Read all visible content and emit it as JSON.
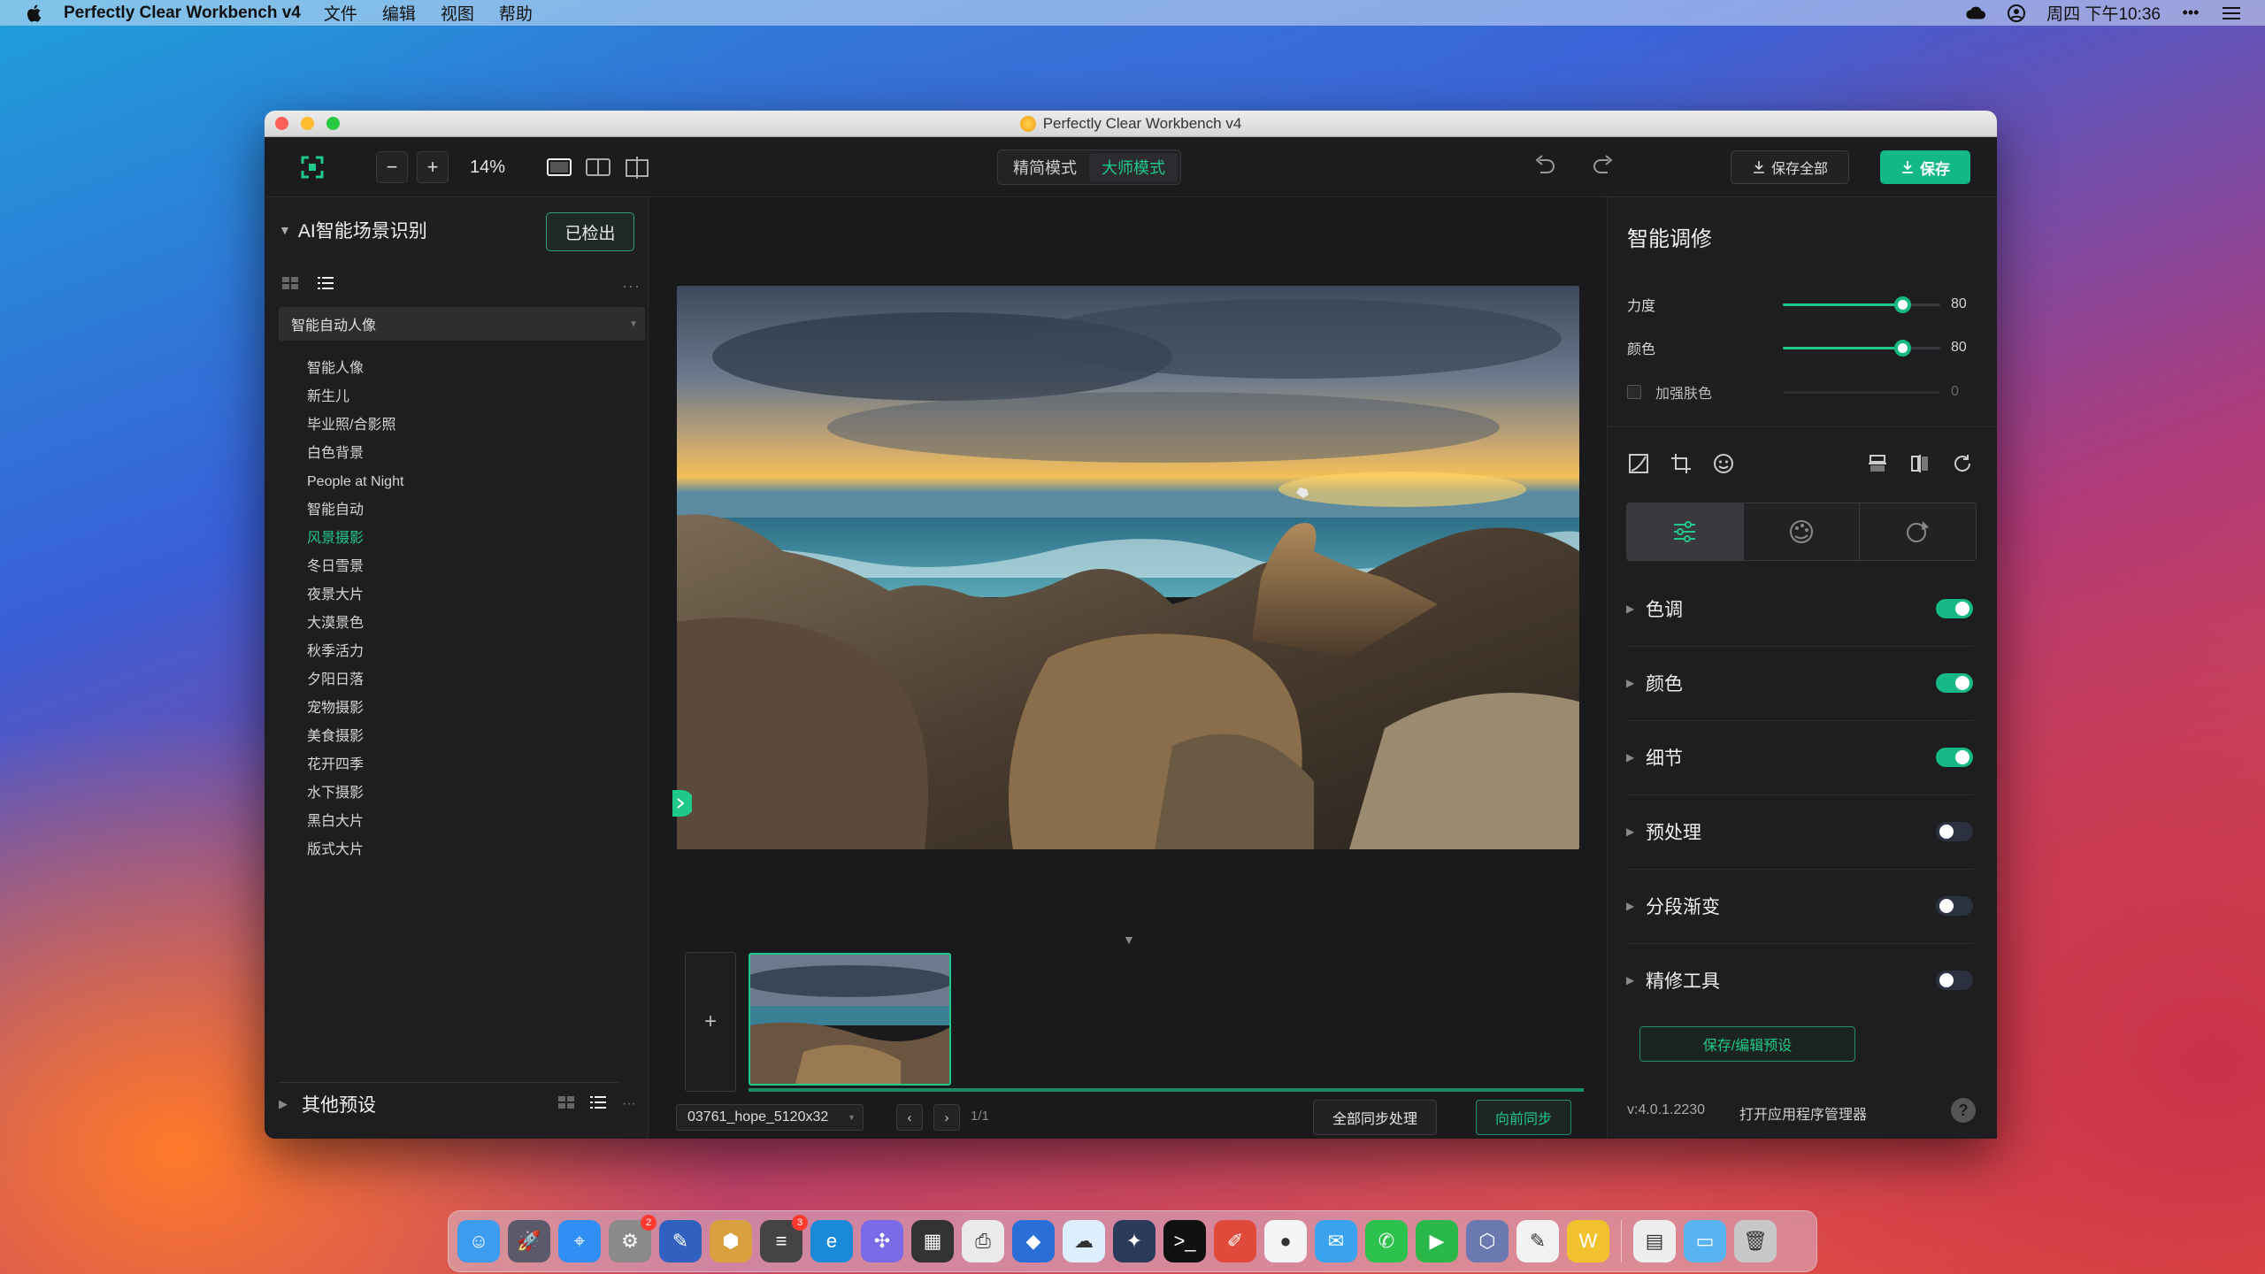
{
  "menubar": {
    "app_name": "Perfectly Clear Workbench v4",
    "menus": [
      "文件",
      "编辑",
      "视图",
      "帮助"
    ],
    "datetime": "周四 下午10:36"
  },
  "window": {
    "title": "Perfectly Clear Workbench v4"
  },
  "toolbar": {
    "zoom_value": "14%",
    "modes": [
      "精简模式",
      "大师模式"
    ],
    "active_mode": "大师模式",
    "save_all_label": "保存全部",
    "save_label": "保存",
    "accent_color": "#12b986"
  },
  "left_panel": {
    "title": "AI智能场景识别",
    "detected_label": "已检出",
    "dropdown_value": "智能自动人像",
    "presets": [
      "智能人像",
      "新生儿",
      "毕业照/合影照",
      "白色背景",
      "People at Night",
      "智能自动",
      "风景摄影",
      "冬日雪景",
      "夜景大片",
      "大漠景色",
      "秋季活力",
      "夕阳日落",
      "宠物摄影",
      "美食摄影",
      "花开四季",
      "水下摄影",
      "黑白大片",
      "版式大片"
    ],
    "active_preset": "风景摄影",
    "other_presets_label": "其他预设"
  },
  "center": {
    "file_name": "03761_hope_5120x32",
    "page_count": "1/1",
    "sync_all_label": "全部同步处理",
    "sync_forward_label": "向前同步",
    "add_label": "+"
  },
  "right_panel": {
    "title": "智能调修",
    "sliders": [
      {
        "label": "力度",
        "value": 80,
        "enabled": true
      },
      {
        "label": "颜色",
        "value": 80,
        "enabled": true
      },
      {
        "label": "加强肤色",
        "value": 0,
        "enabled": false
      }
    ],
    "sections": [
      {
        "label": "色调",
        "on": true
      },
      {
        "label": "颜色",
        "on": true
      },
      {
        "label": "细节",
        "on": true
      },
      {
        "label": "预处理",
        "on": false
      },
      {
        "label": "分段渐变",
        "on": false
      },
      {
        "label": "精修工具",
        "on": false
      }
    ],
    "save_preset_label": "保存/编辑预设",
    "version": "v:4.0.1.2230",
    "open_manager_label": "打开应用程序管理器",
    "help_label": "?"
  },
  "dock": {
    "icons": [
      "finder-icon",
      "launchpad-icon",
      "safari-icon",
      "system-preferences-icon",
      "pencil-icon",
      "package-icon",
      "network-monitor-icon",
      "edge-icon",
      "nodes-icon",
      "calculator-icon",
      "printer-icon",
      "drop-icon",
      "cloud-icon",
      "gear-circle-icon",
      "terminal-icon",
      "paint-icon",
      "qq-icon",
      "mail-icon",
      "wechat-icon",
      "play-icon",
      "installer-icon",
      "notes-icon",
      "wps-icon",
      "document-icon",
      "folder-icon",
      "trash-icon"
    ],
    "badges": {
      "system-preferences-icon": "2",
      "network-monitor-icon": "3"
    }
  }
}
